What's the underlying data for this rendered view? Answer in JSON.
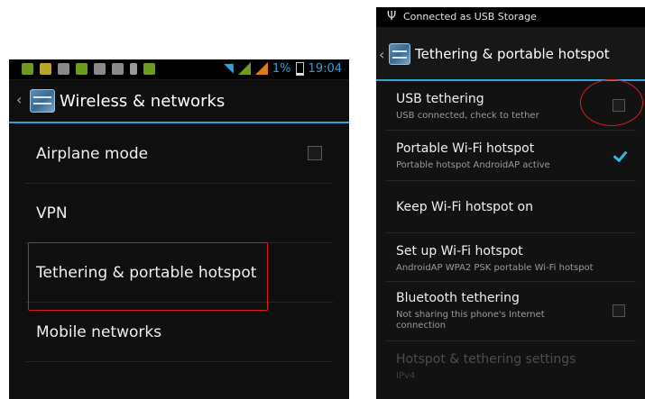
{
  "left_screen": {
    "status": {
      "battery_percent": "1%",
      "time": "19:04"
    },
    "header": {
      "back_icon": "chevron-left",
      "app_icon": "settings-icon",
      "title": "Wireless & networks"
    },
    "items": [
      {
        "label": "Airplane mode",
        "checked": false
      },
      {
        "label": "VPN"
      },
      {
        "label": "Tethering & portable hotspot",
        "highlighted": true
      },
      {
        "label": "Mobile networks"
      }
    ],
    "colors": {
      "accent": "#33a5d6",
      "highlight": "#d81d1d"
    }
  },
  "right_screen": {
    "status": {
      "notification_icon": "usb-icon",
      "notification_text": "Connected as USB Storage"
    },
    "header": {
      "back_icon": "chevron-left",
      "app_icon": "settings-icon",
      "title": "Tethering & portable hotspot"
    },
    "items": [
      {
        "title": "USB tethering",
        "summary": "USB connected, check to tether",
        "checked": false,
        "circled": true
      },
      {
        "title": "Portable Wi-Fi hotspot",
        "summary": "Portable hotspot AndroidAP active",
        "checked": true
      },
      {
        "title": "Keep Wi-Fi hotspot on",
        "summary": ""
      },
      {
        "title": "Set up Wi-Fi hotspot",
        "summary": "AndroidAP WPA2 PSK portable Wi-Fi hotspot"
      },
      {
        "title": "Bluetooth tethering",
        "summary": "Not sharing this phone's Internet connection",
        "checked": false
      },
      {
        "title": "Hotspot & tethering settings",
        "summary": "IPv4",
        "disabled": true
      }
    ],
    "colors": {
      "check": "#33b5e5",
      "annotation": "#d81d1d"
    }
  }
}
